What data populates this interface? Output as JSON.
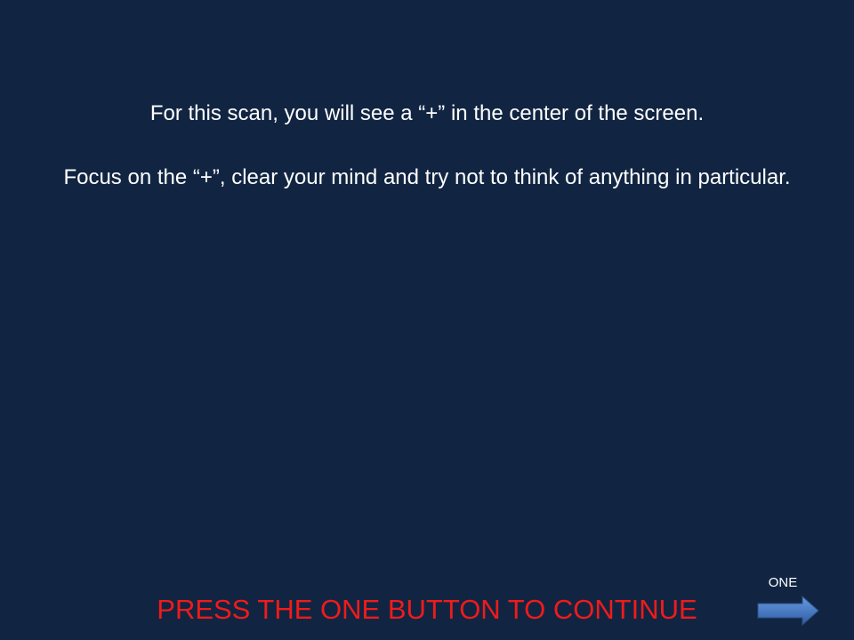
{
  "slide": {
    "background_color": "#112542",
    "instructions": {
      "line1": "For this scan, you will see a “+” in the center of the screen.",
      "line2": "Focus on the “+”, clear your mind and try not to think of anything in particular."
    },
    "continue_prompt": "PRESS THE ONE BUTTON TO CONTINUE",
    "continue_prompt_color": "#ef1b1b",
    "nav_button": {
      "label": "ONE",
      "icon": "right-arrow-icon",
      "arrow_color": "#4a7cc4"
    }
  }
}
